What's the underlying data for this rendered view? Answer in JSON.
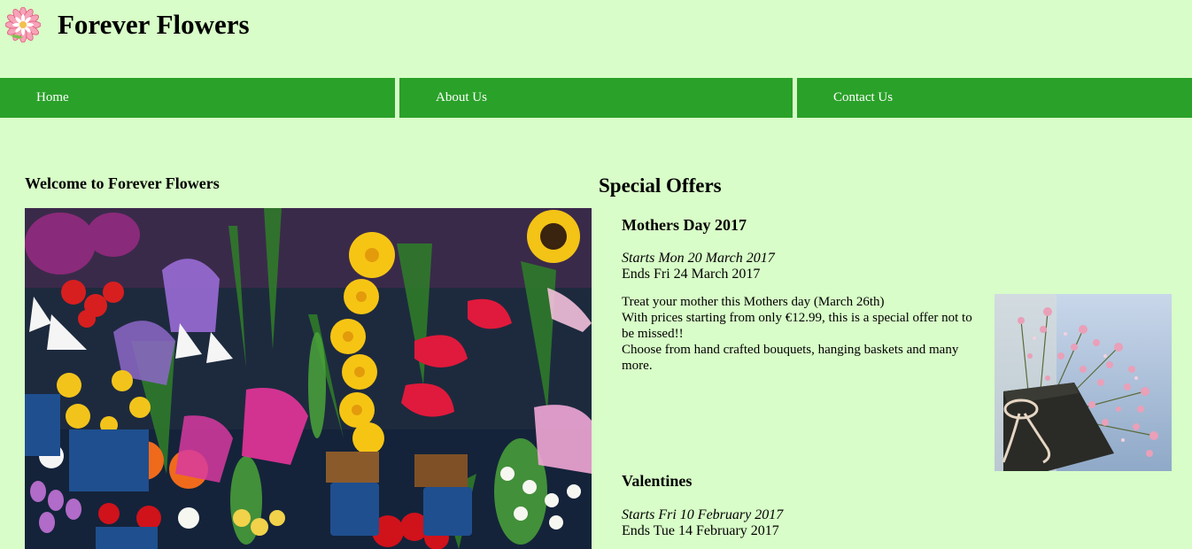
{
  "header": {
    "title": "Forever Flowers",
    "logo_icon": "flower-logo-icon"
  },
  "nav": {
    "items": [
      {
        "label": "Home"
      },
      {
        "label": "About Us"
      },
      {
        "label": "Contact Us"
      }
    ]
  },
  "welcome": {
    "heading": "Welcome to Forever Flowers"
  },
  "offers": {
    "heading": "Special Offers",
    "list": [
      {
        "title": "Mothers Day 2017",
        "starts": "Starts Mon 20 March 2017",
        "ends": "Ends Fri 24 March 2017",
        "description": [
          "Treat your mother this Mothers day (March 26th)",
          "With prices starting from only €12.99, this is a special offer not to be missed!!",
          "Choose from hand crafted bouquets, hanging baskets and many more."
        ]
      },
      {
        "title": "Valentines",
        "starts": "Starts Fri 10 February 2017",
        "ends": "Ends Tue 14 February 2017"
      }
    ]
  },
  "colors": {
    "background": "#d8fdc8",
    "nav_green": "#2aa129",
    "nav_text": "#ffffff"
  }
}
